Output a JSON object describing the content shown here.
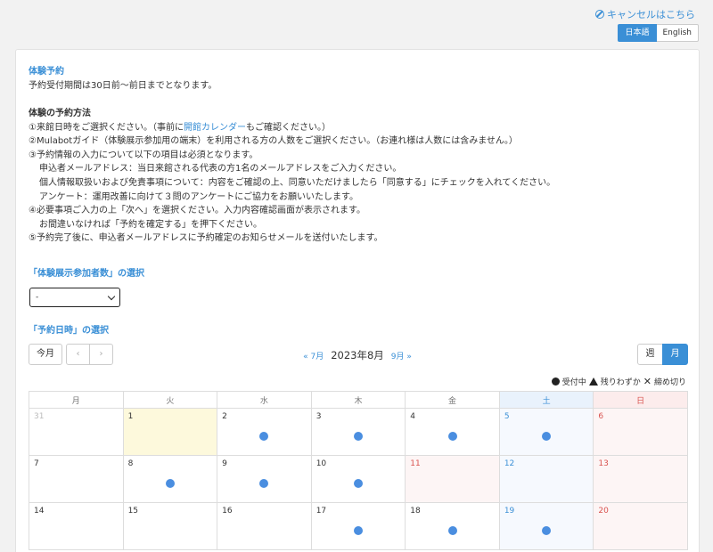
{
  "header": {
    "cancel_link": "キャンセルはこちら",
    "lang_ja": "日本語",
    "lang_en": "English"
  },
  "intro": {
    "title": "体験予約",
    "period_text": "予約受付期間は30日前〜前日までとなります。",
    "method_title": "体験の予約方法",
    "step1_pre": "①来館日時をご選択ください。（事前に",
    "step1_link": "開館カレンダー",
    "step1_post": "もご確認ください。）",
    "step2": "②Mulabotガイド（体験展示参加用の端末）を利用される方の人数をご選択ください。（お連れ様は人数には含みません。）",
    "step3": "③予約情報の入力について以下の項目は必須となります。",
    "step3_a": "申込者メールアドレス：当日来館される代表の方1名のメールアドレスをご入力ください。",
    "step3_b": "個人情報取扱いおよび免責事項について：内容をご確認の上、同意いただけましたら「同意する」にチェックを入れてください。",
    "step3_c": "アンケート：運用改善に向けて３問のアンケートにご協力をお願いいたします。",
    "step4": "④必要事項ご入力の上「次へ」を選択ください。入力内容確認画面が表示されます。",
    "step4_a": "お間違いなければ「予約を確定する」を押下ください。",
    "step5": "⑤予約完了後に、申込者メールアドレスに予約確定のお知らせメールを送付いたします。"
  },
  "participants": {
    "title": "「体験展示参加者数」の選択",
    "selected": "-"
  },
  "date_section": {
    "title": "「予約日時」の選択"
  },
  "toolbar": {
    "today": "今月",
    "prev_icon": "‹",
    "next_icon": "›",
    "prev_month": "« 7月",
    "current_month": "2023年8月",
    "next_month": "9月 »",
    "week": "週",
    "month": "月"
  },
  "legend": {
    "open": "受付中",
    "few": "残りわずか",
    "closed": "締め切り"
  },
  "calendar": {
    "weekdays": [
      "月",
      "火",
      "水",
      "木",
      "金",
      "土",
      "日"
    ],
    "weeks": [
      [
        {
          "d": "31",
          "t": "other"
        },
        {
          "d": "1",
          "t": "today"
        },
        {
          "d": "2",
          "a": true
        },
        {
          "d": "3",
          "a": true
        },
        {
          "d": "4",
          "a": true
        },
        {
          "d": "5",
          "t": "sat",
          "a": true
        },
        {
          "d": "6",
          "t": "sun"
        }
      ],
      [
        {
          "d": "7"
        },
        {
          "d": "8",
          "a": true
        },
        {
          "d": "9",
          "a": true
        },
        {
          "d": "10",
          "a": true
        },
        {
          "d": "11",
          "t": "hol"
        },
        {
          "d": "12",
          "t": "sat"
        },
        {
          "d": "13",
          "t": "sun"
        }
      ],
      [
        {
          "d": "14"
        },
        {
          "d": "15"
        },
        {
          "d": "16"
        },
        {
          "d": "17",
          "a": true
        },
        {
          "d": "18",
          "a": true
        },
        {
          "d": "19",
          "t": "sat",
          "a": true
        },
        {
          "d": "20",
          "t": "sun"
        }
      ]
    ]
  },
  "colors": {
    "accent": "#3a8fd6",
    "available_dot": "#4a8ee0",
    "today_bg": "#fdf9dc",
    "sunday": "#d9534f"
  }
}
